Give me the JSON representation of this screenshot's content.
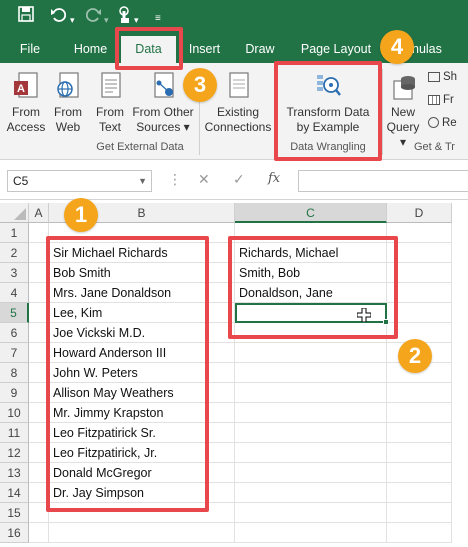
{
  "colors": {
    "excel_green": "#217346",
    "highlight_red": "#e8484c",
    "badge_orange": "#f4a51c"
  },
  "qat": {
    "icons": [
      "save-icon",
      "undo-icon",
      "redo-icon",
      "touch-mode-icon",
      "customize-icon"
    ]
  },
  "tabs": [
    "File",
    "Home",
    "Data",
    "Insert",
    "Draw",
    "Page Layout",
    "nulas"
  ],
  "active_tab": "Data",
  "ribbon": {
    "from_access": [
      "From",
      "Access"
    ],
    "from_web": [
      "From",
      "Web"
    ],
    "from_text": [
      "From",
      "Text"
    ],
    "from_other": [
      "From Other",
      "Sources ▾"
    ],
    "existing": [
      "Existing",
      "Connections"
    ],
    "get_external_data": "Get External Data",
    "transform": [
      "Transform Data",
      "by Example"
    ],
    "data_wrangling": "Data Wrangling",
    "new_query": [
      "New",
      "Query ▾"
    ],
    "sh": "Sh",
    "fr": "Fr",
    "re": "Re",
    "get_tr": "Get & Tr"
  },
  "formula_bar": {
    "name_box": "C5",
    "cancel": "✕",
    "enter": "✓",
    "fx": "fx",
    "formula": ""
  },
  "grid": {
    "columns": [
      "A",
      "B",
      "C",
      "D"
    ],
    "rows": [
      "1",
      "2",
      "3",
      "4",
      "5",
      "6",
      "7",
      "8",
      "9",
      "10",
      "11",
      "12",
      "13",
      "14",
      "15",
      "16"
    ],
    "selected_cell": "C5",
    "column_b": [
      "",
      "Sir Michael Richards",
      "Bob Smith",
      "Mrs. Jane Donaldson",
      "Lee, Kim",
      "Joe Vickski M.D.",
      "Howard Anderson III",
      "John W. Peters",
      "Allison May Weathers",
      "Mr. Jimmy Krapston",
      "Leo Fitzpatirick Sr.",
      "Leo Fitzpatirick, Jr.",
      "Donald McGregor",
      "Dr. Jay Simpson",
      "",
      ""
    ],
    "column_c": [
      "",
      "Richards, Michael",
      "Smith, Bob",
      "Donaldson, Jane",
      "",
      "",
      "",
      "",
      "",
      "",
      "",
      "",
      "",
      "",
      "",
      ""
    ]
  },
  "badges": [
    "1",
    "2",
    "3",
    "4"
  ]
}
